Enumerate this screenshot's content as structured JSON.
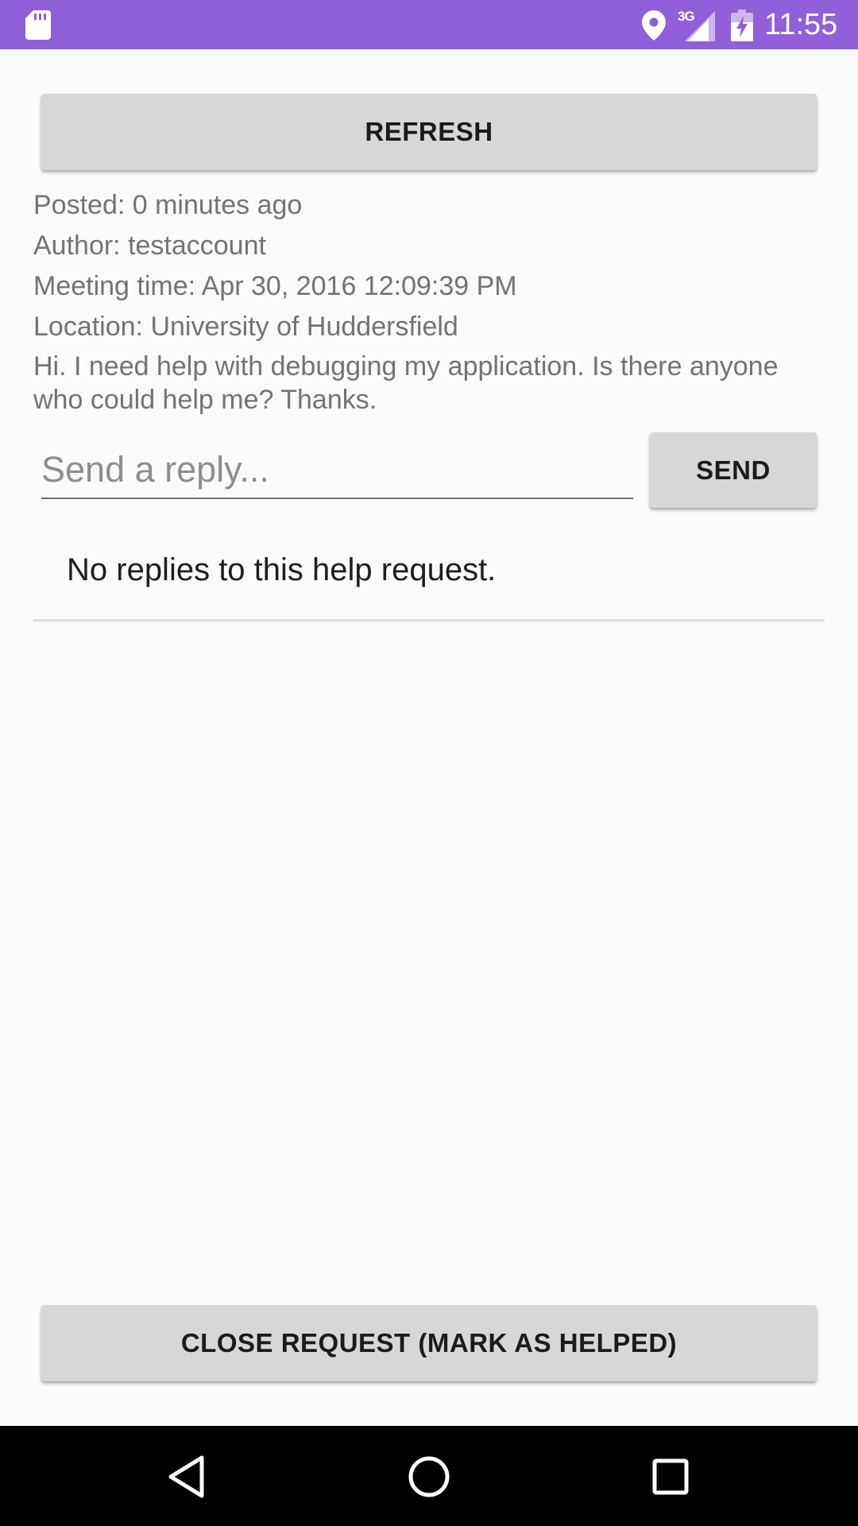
{
  "status_bar": {
    "network_type": "3G",
    "time": "11:55",
    "icons": [
      "sd-card-icon",
      "location-icon",
      "signal-icon",
      "battery-charging-icon"
    ]
  },
  "toolbar": {
    "refresh_label": "REFRESH"
  },
  "request": {
    "posted": "Posted: 0 minutes ago",
    "author": "Author: testaccount",
    "meeting_time": "Meeting time: Apr 30, 2016 12:09:39 PM",
    "location": "Location: University of Huddersfield",
    "message": "Hi. I need help with debugging my application. Is there anyone who could help me? Thanks."
  },
  "reply": {
    "placeholder": "Send a reply...",
    "value": "",
    "send_label": "SEND"
  },
  "replies": {
    "empty_text": "No replies to this help request."
  },
  "actions": {
    "close_label": "CLOSE REQUEST (MARK AS HELPED)"
  },
  "nav_bar": {
    "icons": [
      "back-icon",
      "home-icon",
      "recent-apps-icon"
    ]
  },
  "colors": {
    "status_bar": "#915fd9",
    "background": "#fafafa",
    "button": "#d6d7d7",
    "nav_bar": "#000000"
  }
}
